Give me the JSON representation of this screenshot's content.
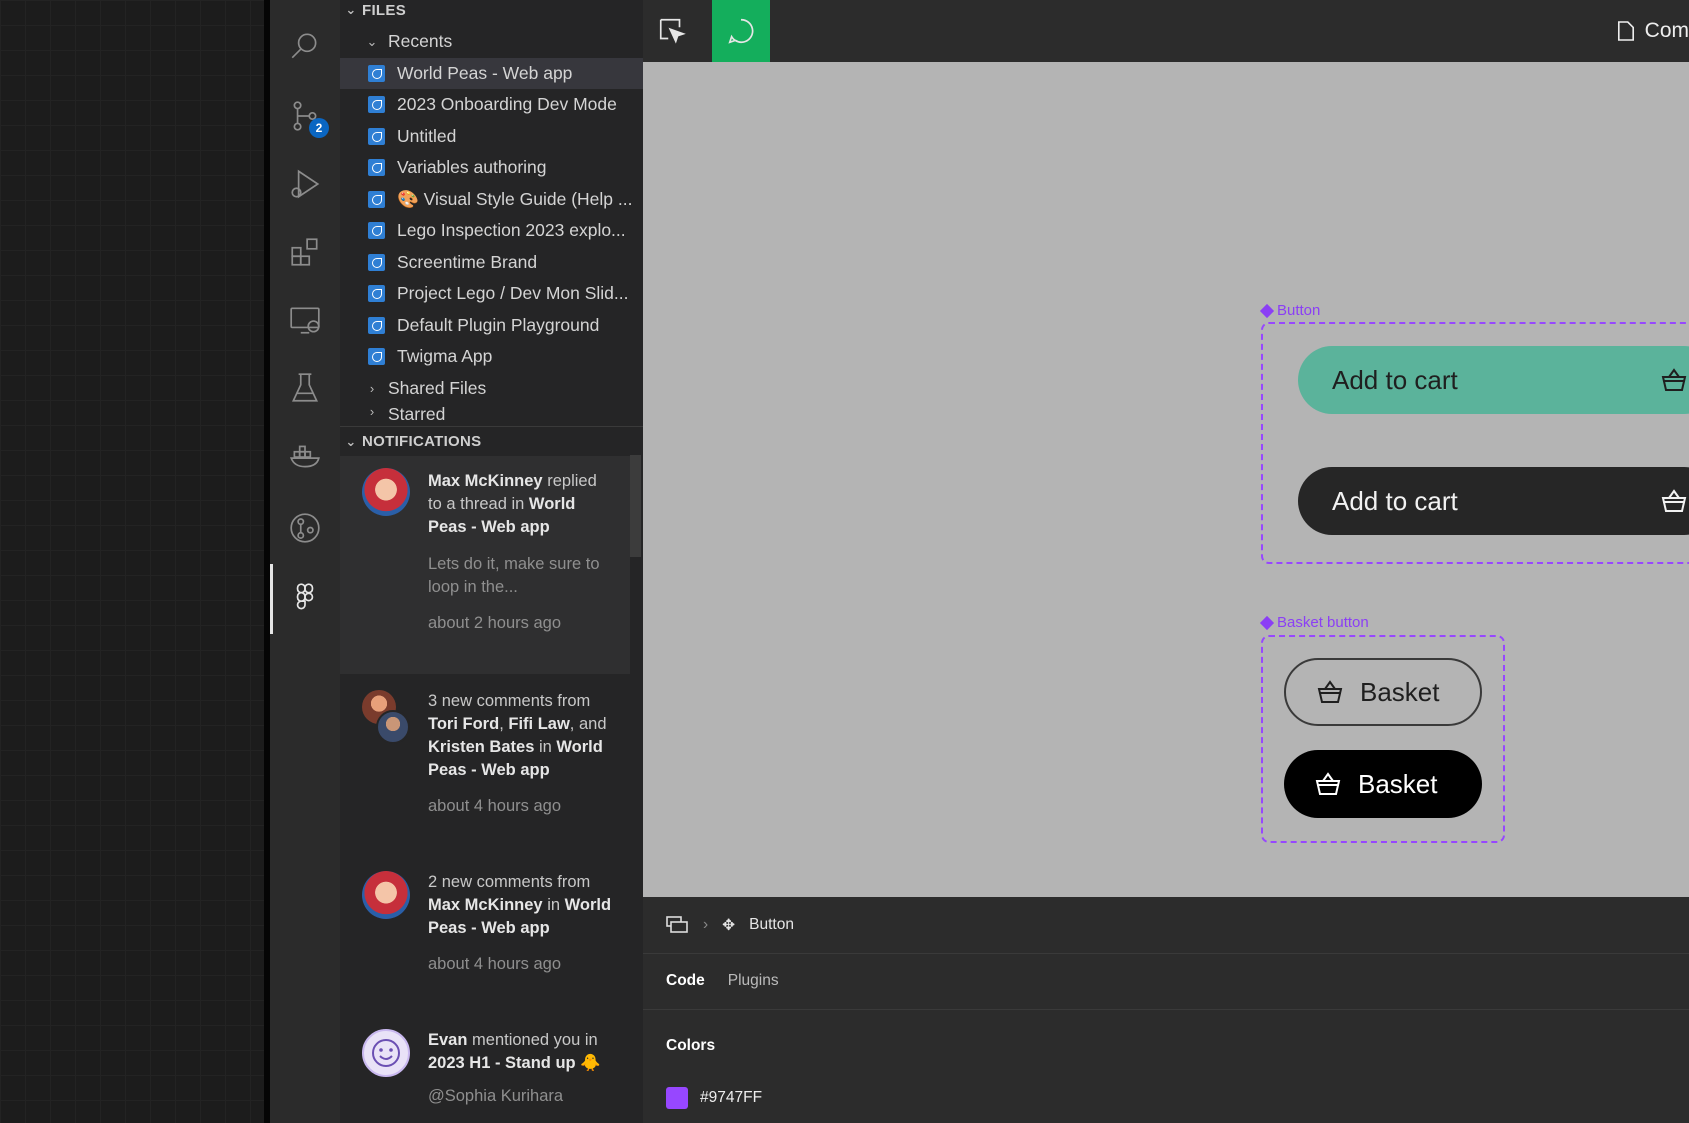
{
  "activity_bar": {
    "scm_badge": "2"
  },
  "files": {
    "section_title": "FILES",
    "recents_label": "Recents",
    "recents": [
      "World Peas - Web app",
      "2023 Onboarding Dev Mode",
      "Untitled",
      "Variables authoring",
      "🎨 Visual Style Guide (Help ...",
      "Lego Inspection 2023 explo...",
      "Screentime Brand",
      "Project Lego / Dev Mon Slid...",
      "Default Plugin Playground",
      "Twigma App"
    ],
    "shared_label": "Shared Files",
    "starred_label": "Starred"
  },
  "notifications": {
    "section_title": "NOTIFICATIONS",
    "n1": {
      "name": "Max McKinney",
      "text1": "replied to a thread in",
      "file": "World Peas - Web app",
      "preview": "Lets do it, make sure to loop in the...",
      "time": "about 2 hours ago"
    },
    "n2": {
      "t1": "3 new comments from",
      "p1": "Tori Ford",
      "sep1": ",",
      "p2": "Fifi Law",
      "t2": ", and",
      "p3": "Kristen Bates",
      "t3": "in",
      "file": "World Peas - Web app",
      "time": "about 4 hours ago"
    },
    "n3": {
      "t1": "2 new comments from",
      "p1": "Max McKinney",
      "t2": "in",
      "file": "World Peas - Web app",
      "time": "about 4 hours ago"
    },
    "n4": {
      "name": "Evan",
      "t1": "mentioned you in",
      "file": "2023 H1 - Stand up 🐥",
      "preview": "@Sophia Kurihara"
    }
  },
  "topbar": {
    "right_label": "Com"
  },
  "canvas": {
    "button_component_label": "Button",
    "add_to_cart_primary": "Add to cart",
    "add_to_cart_dark": "Add to cart",
    "basket_component_label": "Basket button",
    "basket_outline": "Basket",
    "basket_filled": "Basket",
    "colors": {
      "accent_teal": "#5bb39b",
      "frame_purple": "#9747FF",
      "dark_button": "#262626",
      "black_button": "#000000"
    }
  },
  "inspector": {
    "breadcrumb_item": "Button",
    "tabs": [
      "Code",
      "Plugins"
    ],
    "colors_heading": "Colors",
    "color_value": "#9747FF"
  }
}
